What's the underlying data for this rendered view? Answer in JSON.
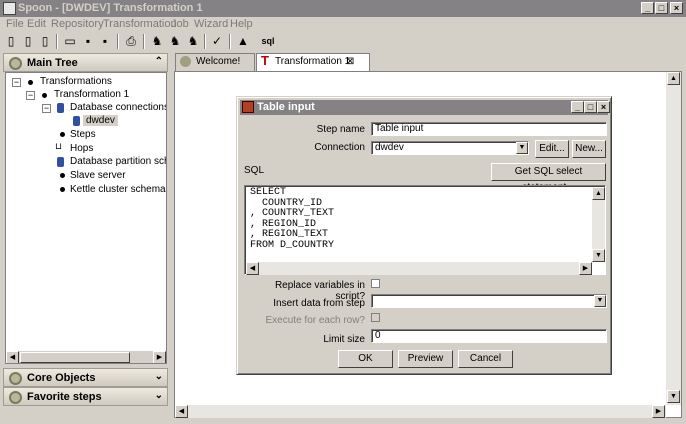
{
  "window": {
    "title": "Spoon - [DWDEV] Transformation 1"
  },
  "menu": [
    "File",
    "Edit",
    "Repository",
    "Transformation",
    "Job",
    "Wizard",
    "Help"
  ],
  "toolbar": {
    "sql_label": "sql"
  },
  "panels": {
    "main_tree": "Main Tree",
    "core_objects": "Core Objects",
    "favorite_steps": "Favorite steps"
  },
  "tree": {
    "transformations": "Transformations",
    "transformation1": "Transformation 1",
    "db_connections": "Database connections",
    "dwdev": "dwdev",
    "steps": "Steps",
    "hops": "Hops",
    "partition": "Database partition schemas",
    "slave": "Slave server",
    "cluster": "Kettle cluster schemas"
  },
  "tabs": {
    "welcome": "Welcome!",
    "transformation": "Transformation 1"
  },
  "dialog": {
    "title": "Table input",
    "step_name_label": "Step name",
    "step_name_value": "Table input",
    "connection_label": "Connection",
    "connection_value": "dwdev",
    "edit_btn": "Edit...",
    "new_btn": "New...",
    "sql_label": "SQL",
    "get_sql_btn": "Get SQL select statement...",
    "sql_lines": [
      "SELECT",
      "  COUNTRY_ID",
      ", COUNTRY_TEXT",
      ", REGION_ID",
      ", REGION_TEXT",
      "FROM D_COUNTRY"
    ],
    "replace_vars_label": "Replace variables in script?",
    "insert_from_label": "Insert data from step",
    "exec_each_label": "Execute for each row?",
    "limit_label": "Limit size",
    "limit_value": "0",
    "ok_btn": "OK",
    "preview_btn": "Preview",
    "cancel_btn": "Cancel"
  }
}
